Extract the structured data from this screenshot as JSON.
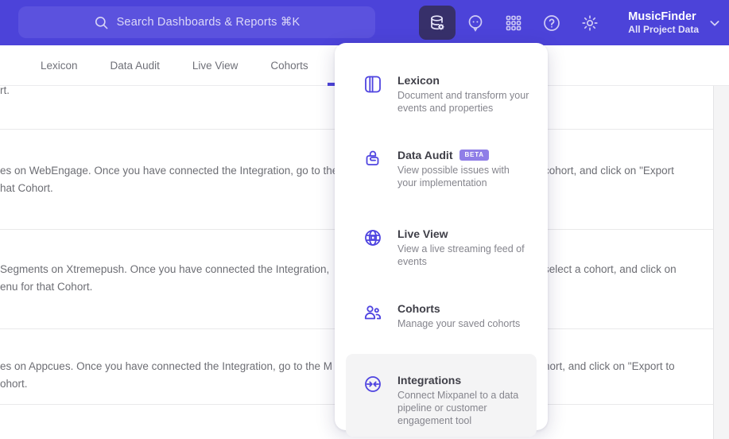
{
  "colors": {
    "topbar": "#4c43d9",
    "accent_icon": "#4f44e0",
    "badge": "#8f7ee7",
    "highlight_row": "#f4f4f5"
  },
  "topbar": {
    "search_placeholder": "Search Dashboards & Reports ⌘K",
    "project_name": "MusicFinder",
    "project_subtitle": "All Project Data"
  },
  "tabs": {
    "items": [
      {
        "label": "Lexicon"
      },
      {
        "label": "Data Audit"
      },
      {
        "label": "Live View"
      },
      {
        "label": "Cohorts"
      }
    ]
  },
  "menu": {
    "items": [
      {
        "title": "Lexicon",
        "desc": "Document and transform your events and properties"
      },
      {
        "title": "Data Audit",
        "badge": "BETA",
        "desc": "View possible issues with your implementation"
      },
      {
        "title": "Live View",
        "desc": "View a live streaming feed of events"
      },
      {
        "title": "Cohorts",
        "desc": "Manage your saved cohorts"
      },
      {
        "title": "Integrations",
        "desc": "Connect Mixpanel to a data pipeline or customer engagement tool"
      }
    ]
  },
  "background": {
    "rows": [
      {
        "left1": "rt.",
        "right1": "",
        "line2": ""
      },
      {
        "left1": "es on WebEngage. Once you have connected the Integration, go to the",
        "right1": "cohort, and click on \"Export",
        "line2": "hat Cohort."
      },
      {
        "left1": "Segments on Xtremepush. Once you have connected the Integration,",
        "right1": "select a cohort, and click on",
        "line2": "enu for that Cohort."
      },
      {
        "left1": "es on Appcues. Once you have connected the Integration, go to the M",
        "right1": "hort, and click on \"Export to",
        "line2": "ohort."
      }
    ]
  }
}
